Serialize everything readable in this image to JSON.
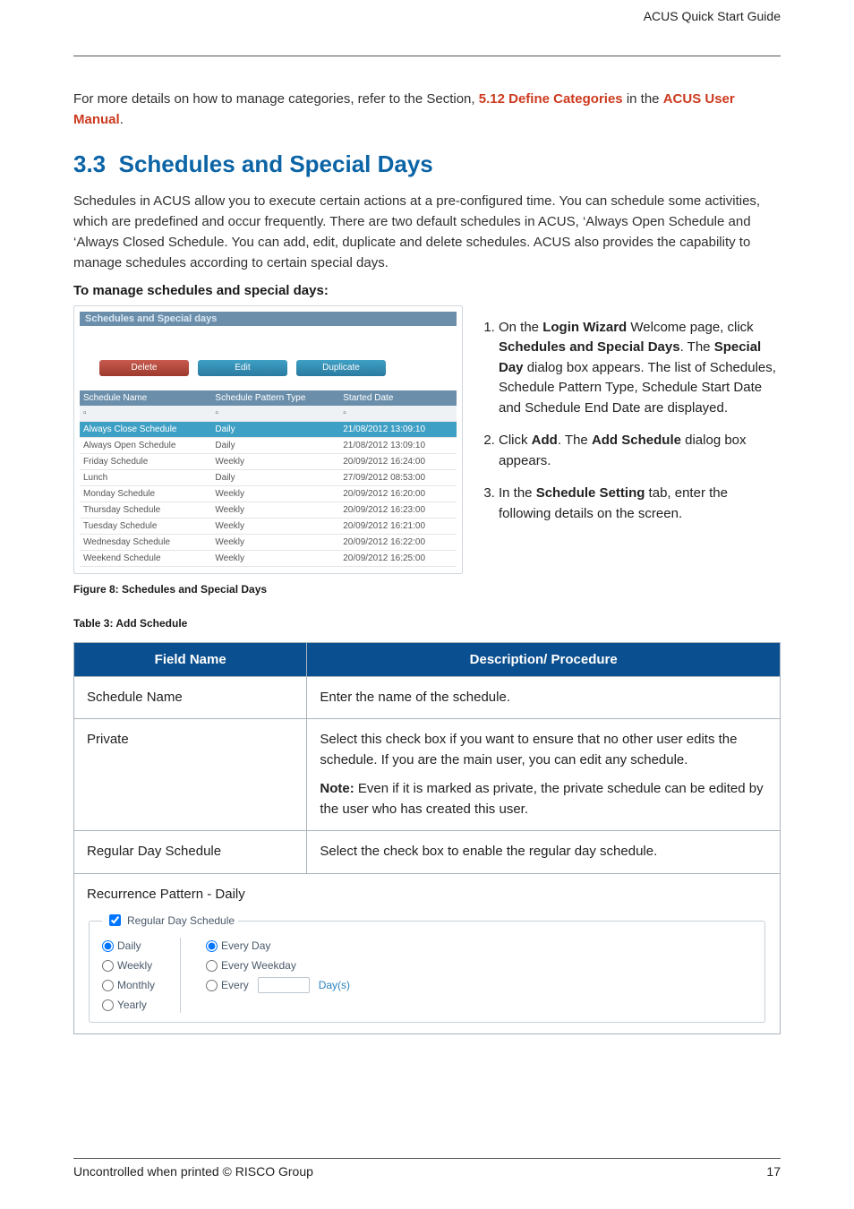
{
  "header": {
    "title": "ACUS Quick Start Guide"
  },
  "intro": {
    "prefix": "For more details on how to manage categories, refer to the Section, ",
    "link1": "5.12 Define Categories",
    "middle": " in the ",
    "link2": "ACUS User Manual",
    "suffix": "."
  },
  "section": {
    "number": "3.3",
    "title": "Schedules and Special Days"
  },
  "para": "Schedules in ACUS allow you to execute certain actions at a pre-configured time. You can schedule some activities, which are predefined and occur frequently. There are two default schedules in ACUS, ‘Always Open Schedule and ‘Always Closed Schedule. You can add, edit, duplicate and delete schedules. ACUS also provides the capability to manage schedules according to certain special days.",
  "subhdr": "To manage schedules and special days",
  "figure": {
    "panel_title": "Schedules and Special days",
    "buttons": {
      "delete": "Delete",
      "edit": "Edit",
      "duplicate": "Duplicate"
    },
    "cols": {
      "name": "Schedule Name",
      "type": "Schedule Pattern Type",
      "date": "Started Date"
    },
    "rows": [
      {
        "name": "Always Close Schedule",
        "type": "Daily",
        "date": "21/08/2012 13:09:10",
        "sel": true
      },
      {
        "name": "Always Open Schedule",
        "type": "Daily",
        "date": "21/08/2012 13:09:10"
      },
      {
        "name": "Friday Schedule",
        "type": "Weekly",
        "date": "20/09/2012 16:24:00"
      },
      {
        "name": "Lunch",
        "type": "Daily",
        "date": "27/09/2012 08:53:00"
      },
      {
        "name": "Monday Schedule",
        "type": "Weekly",
        "date": "20/09/2012 16:20:00"
      },
      {
        "name": "Thursday Schedule",
        "type": "Weekly",
        "date": "20/09/2012 16:23:00"
      },
      {
        "name": "Tuesday Schedule",
        "type": "Weekly",
        "date": "20/09/2012 16:21:00"
      },
      {
        "name": "Wednesday Schedule",
        "type": "Weekly",
        "date": "20/09/2012 16:22:00"
      },
      {
        "name": "Weekend Schedule",
        "type": "Weekly",
        "date": "20/09/2012 16:25:00"
      }
    ],
    "caption": "Figure 8: Schedules and Special Days"
  },
  "steps": [
    {
      "pre": "On the ",
      "b1": "Login Wizard",
      "mid1": " Welcome page, click ",
      "b2": "Schedules and Special Days",
      "mid2": ". The ",
      "b3": "Special Day",
      "tail": " dialog box appears. The list of Schedules, Schedule Pattern Type, Schedule Start Date and Schedule End Date are displayed."
    },
    {
      "pre": "Click ",
      "b1": "Add",
      "mid1": ". The ",
      "b2": "Add Schedule",
      "tail": " dialog box appears."
    },
    {
      "pre": "In the ",
      "b1": "Schedule Setting",
      "tail": " tab, enter the following details on the screen."
    }
  ],
  "table": {
    "caption": "Table 3: Add Schedule",
    "head": {
      "c1": "Field Name",
      "c2": "Description/ Procedure"
    },
    "rows": {
      "r1": {
        "name": "Schedule Name",
        "desc": "Enter the name of the schedule."
      },
      "r2": {
        "name": "Private",
        "p1": "Select this check box if you want to ensure that no other user edits the schedule. If you are the main user, you can edit any schedule.",
        "noteLabel": "Note:",
        "noteText": " Even if it is marked as private, the private schedule can be edited by the user who has created this user."
      },
      "r3": {
        "name": "Regular Day Schedule",
        "desc": "Select the check box to enable the regular day schedule."
      },
      "r4": {
        "title": "Recurrence Pattern - Daily",
        "legend": "Regular Day Schedule",
        "left": {
          "daily": "Daily",
          "weekly": "Weekly",
          "monthly": "Monthly",
          "yearly": "Yearly"
        },
        "right": {
          "everyDay": "Every Day",
          "everyWeekday": "Every Weekday",
          "every": "Every",
          "days": "Day(s)"
        }
      }
    }
  },
  "footer": {
    "left": "Uncontrolled when printed © RISCO Group",
    "right": "17"
  }
}
